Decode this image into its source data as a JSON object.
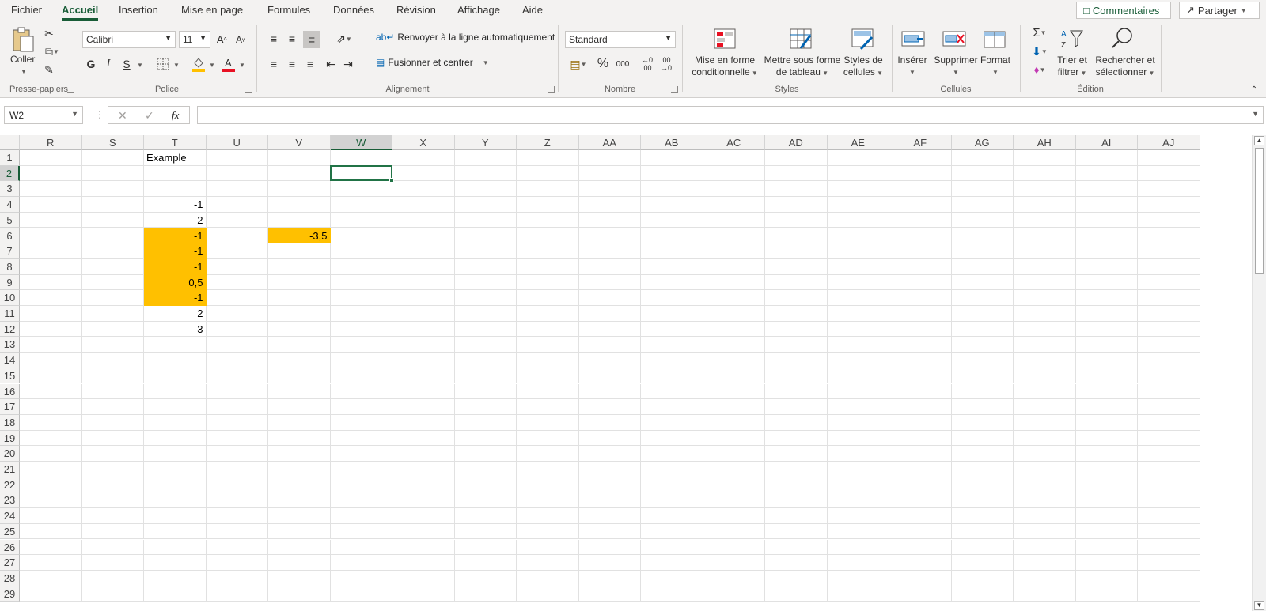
{
  "menu": {
    "tabs": [
      "Fichier",
      "Accueil",
      "Insertion",
      "Mise en page",
      "Formules",
      "Données",
      "Révision",
      "Affichage",
      "Aide"
    ],
    "active_tab": "Accueil",
    "comments_label": "Commentaires",
    "share_label": "Partager"
  },
  "ribbon": {
    "clipboard": {
      "group": "Presse-papiers",
      "paste": "Coller"
    },
    "font": {
      "group": "Police",
      "font_name": "Calibri",
      "font_size": "11",
      "bold": "G",
      "italic": "I",
      "underline": "S"
    },
    "alignment": {
      "group": "Alignement",
      "wrap": "Renvoyer à la ligne automatiquement",
      "merge": "Fusionner et centrer"
    },
    "number": {
      "group": "Nombre",
      "format": "Standard"
    },
    "styles": {
      "group": "Styles",
      "conditional_1": "Mise en forme",
      "conditional_2": "conditionnelle",
      "table_1": "Mettre sous forme",
      "table_2": "de tableau",
      "cell_styles_1": "Styles de",
      "cell_styles_2": "cellules"
    },
    "cells": {
      "group": "Cellules",
      "insert": "Insérer",
      "delete": "Supprimer",
      "format": "Format"
    },
    "editing": {
      "group": "Édition",
      "sort_1": "Trier et",
      "sort_2": "filtrer",
      "find_1": "Rechercher et",
      "find_2": "sélectionner"
    }
  },
  "formula_bar": {
    "name_box": "W2",
    "formula": ""
  },
  "sheet": {
    "columns": [
      "R",
      "S",
      "T",
      "U",
      "V",
      "W",
      "X",
      "Y",
      "Z",
      "AA",
      "AB",
      "AC",
      "AD",
      "AE",
      "AF",
      "AG",
      "AH",
      "AI",
      "AJ"
    ],
    "selected_column": "W",
    "selected_row": 2,
    "rows": 29,
    "cells": [
      {
        "col": "T",
        "row": 1,
        "value": "Example",
        "align": "left",
        "fill": ""
      },
      {
        "col": "T",
        "row": 4,
        "value": "-1",
        "align": "right",
        "fill": ""
      },
      {
        "col": "T",
        "row": 5,
        "value": "2",
        "align": "right",
        "fill": ""
      },
      {
        "col": "T",
        "row": 6,
        "value": "-1",
        "align": "right",
        "fill": "#ffc000"
      },
      {
        "col": "T",
        "row": 7,
        "value": "-1",
        "align": "right",
        "fill": "#ffc000"
      },
      {
        "col": "T",
        "row": 8,
        "value": "-1",
        "align": "right",
        "fill": "#ffc000"
      },
      {
        "col": "T",
        "row": 9,
        "value": "0,5",
        "align": "right",
        "fill": "#ffc000"
      },
      {
        "col": "T",
        "row": 10,
        "value": "-1",
        "align": "right",
        "fill": "#ffc000"
      },
      {
        "col": "T",
        "row": 11,
        "value": "2",
        "align": "right",
        "fill": ""
      },
      {
        "col": "T",
        "row": 12,
        "value": "3",
        "align": "right",
        "fill": ""
      },
      {
        "col": "V",
        "row": 6,
        "value": "-3,5",
        "align": "right",
        "fill": "#ffc000"
      }
    ]
  },
  "colors": {
    "accent": "#185c37",
    "highlight": "#ffc000",
    "font_color_bar": "#e81123",
    "fill_color_bar": "#ffc000"
  }
}
